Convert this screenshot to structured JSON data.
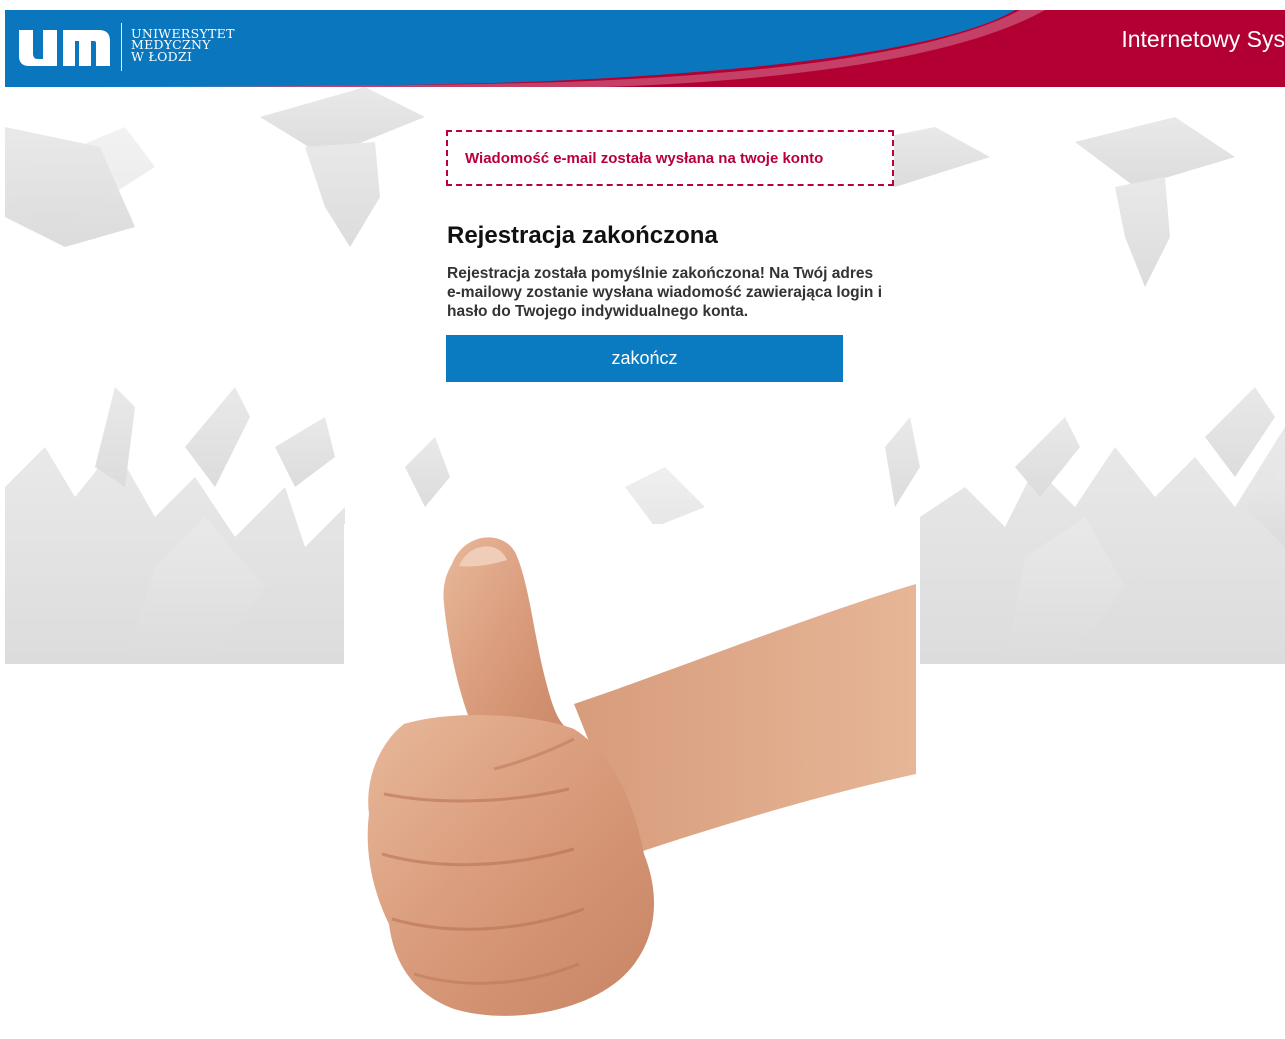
{
  "header": {
    "logo_initials": "um",
    "logo_line1": "UNIWERSYTET",
    "logo_line2": "MEDYCZNY",
    "logo_line3": "W ŁODZI",
    "system_title": "Internetowy Sys",
    "colors": {
      "blue": "#0a76bd",
      "crimson": "#b20033"
    }
  },
  "alert": {
    "text": "Wiadomość e-mail została wysłana na twoje konto",
    "color": "#b8003b"
  },
  "main": {
    "title": "Rejestracja zakończona",
    "message_lines": [
      "Rejestracja została pomyślnie zakończona! Na Twój adres",
      "e-mailowy zostanie wysłana wiadomość zawierająca login i",
      "hasło do Twojego indywidualnego konta."
    ],
    "button_label": "zakończ",
    "button_color": "#0a7bc1"
  },
  "illustration": {
    "background": "graduation-celebration-silhouettes",
    "image": "thumbs-up-hand"
  }
}
